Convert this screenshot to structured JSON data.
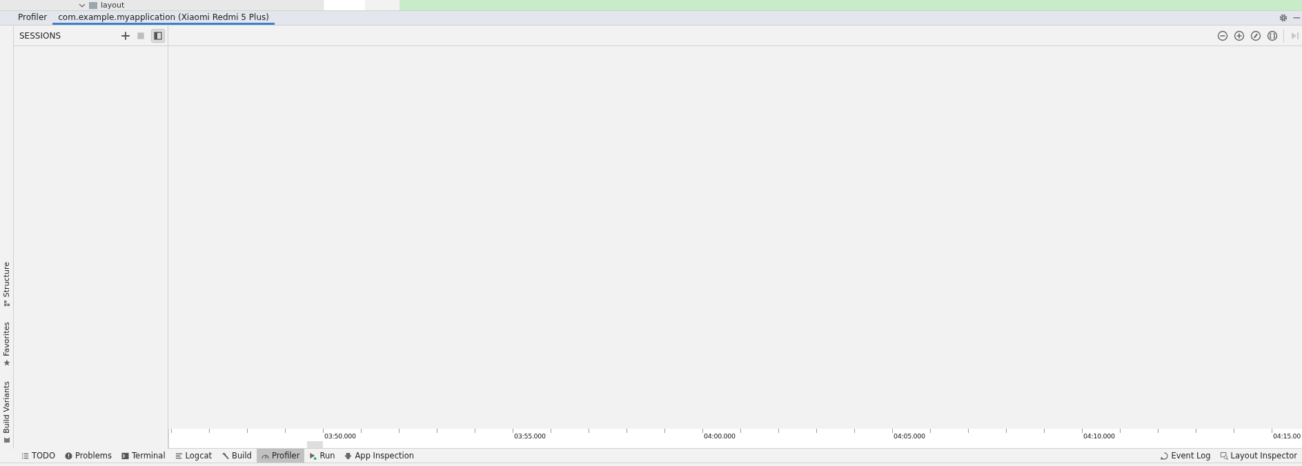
{
  "editor_strip": {
    "tree_item": "layout"
  },
  "tabs": [
    {
      "label": "Profiler",
      "selected": false
    },
    {
      "label": "com.example.myapplication (Xiaomi Redmi 5 Plus)",
      "selected": true
    }
  ],
  "left_tool_windows": [
    {
      "label": "Structure",
      "kind": "structure"
    },
    {
      "label": "Favorites",
      "kind": "favorites"
    },
    {
      "label": "Build Variants",
      "kind": "variants"
    }
  ],
  "sessions": {
    "title": "SESSIONS",
    "stop_disabled": true,
    "panel_toggle_selected": true
  },
  "timeline": {
    "labels": [
      "03:50.000",
      "03:55.000",
      "04:00.000",
      "04:05.000",
      "04:10.000",
      "04:15.00"
    ]
  },
  "bottom_tools": [
    {
      "label": "TODO",
      "kind": "todo",
      "selected": false
    },
    {
      "label": "Problems",
      "kind": "problems",
      "selected": false
    },
    {
      "label": "Terminal",
      "kind": "terminal",
      "selected": false
    },
    {
      "label": "Logcat",
      "kind": "logcat",
      "selected": false
    },
    {
      "label": "Build",
      "kind": "build",
      "selected": false
    },
    {
      "label": "Profiler",
      "kind": "profiler",
      "selected": true
    },
    {
      "label": "Run",
      "kind": "run",
      "selected": false
    },
    {
      "label": "App Inspection",
      "kind": "inspection",
      "selected": false
    }
  ],
  "right_tools": [
    {
      "label": "Event Log",
      "kind": "events"
    },
    {
      "label": "Layout Inspector",
      "kind": "inspector"
    }
  ]
}
